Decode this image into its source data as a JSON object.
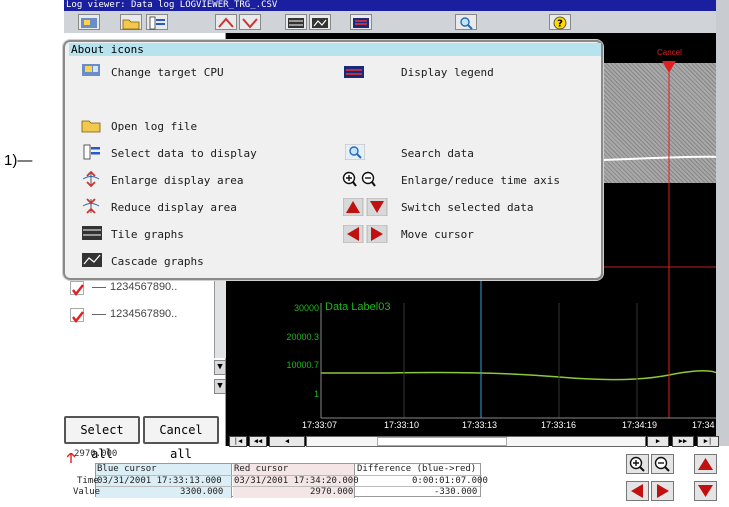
{
  "window": {
    "title": "Log viewer: Data log LOGVIEWER_TRG_.CSV"
  },
  "callout": {
    "label": "1)—"
  },
  "popup": {
    "title": "About icons",
    "items": [
      {
        "label": "Change target CPU",
        "icon": "change-cpu-icon"
      },
      {
        "label": "Display legend",
        "icon": "display-legend-icon"
      },
      {
        "label": "Open log file",
        "icon": "folder-open-icon"
      },
      {
        "label": "Select data to display",
        "icon": "select-data-icon"
      },
      {
        "label": "Search data",
        "icon": "magnifier-icon"
      },
      {
        "label": "Enlarge display area",
        "icon": "enlarge-area-icon"
      },
      {
        "label": "Enlarge/reduce time axis",
        "icon": "zoom-in-out-icon"
      },
      {
        "label": "Reduce display area",
        "icon": "reduce-area-icon"
      },
      {
        "label": "Switch selected data",
        "icon": "up-down-triangle-icon"
      },
      {
        "label": "Tile graphs",
        "icon": "tile-graphs-icon"
      },
      {
        "label": "Move cursor",
        "icon": "left-right-triangle-icon"
      },
      {
        "label": "Cascade graphs",
        "icon": "cascade-graphs-icon"
      }
    ]
  },
  "chart": {
    "cancel_marker": "Cancel",
    "data_label": "Data Label03",
    "y_ticks": [
      "30000",
      "20000.3",
      "10000.7",
      "1"
    ],
    "x_ticks": [
      "17:33:07",
      "17:33:10",
      "17:33:13",
      "17:33:16",
      "17:34:19",
      "17:34"
    ]
  },
  "legend_rows": [
    {
      "checked": true,
      "text": "1234567890.."
    },
    {
      "checked": true,
      "text": "1234567890.."
    }
  ],
  "buttons": {
    "select_all": "Select all",
    "cancel_all": "Cancel all"
  },
  "info": {
    "top_value": "2970.000",
    "blue_cursor": "Blue cursor",
    "red_cursor": "Red cursor",
    "difference": "Difference (blue->red)",
    "time_label": "Time",
    "value_label": "Value",
    "blue_time": "03/31/2001 17:33:13.000",
    "red_time": "03/31/2001 17:34:20.000",
    "diff_time": "0:00:01:07.000",
    "blue_value": "3300.000",
    "red_value": "2970.000",
    "diff_value": "-330.000"
  },
  "colors": {
    "accent_cursor": "#e02020",
    "blue_cursor": "#2aa8d8",
    "trace": "#8ac83a",
    "popup_header": "#b7e3ef"
  }
}
